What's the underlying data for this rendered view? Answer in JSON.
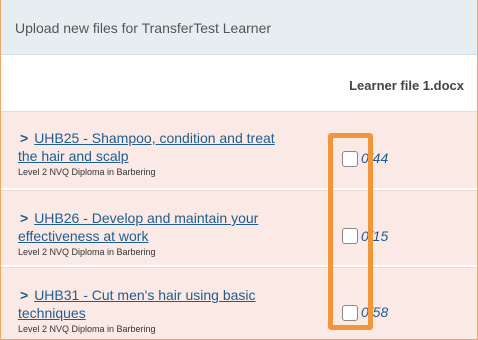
{
  "header": {
    "title": "Upload new files for TransferTest Learner"
  },
  "columns": {
    "file_label": "Learner file 1.docx"
  },
  "units": [
    {
      "title_line1": "UHB25 - Shampoo, condition and treat",
      "title_line2": "the hair and scalp",
      "qualification": "Level 2 NVQ Diploma in Barbering",
      "count": "0/44"
    },
    {
      "title_line1": "UHB26 - Develop and maintain your",
      "title_line2": "effectiveness at work",
      "qualification": "Level 2 NVQ Diploma in Barbering",
      "count": "0/15"
    },
    {
      "title_line1": "UHB31 - Cut men's hair using basic",
      "title_line2": "techniques",
      "qualification": "Level 2 NVQ Diploma in Barbering",
      "count": "0/58"
    }
  ],
  "colors": {
    "header_bg": "#e7eef2",
    "row_bg": "#fbe9e5",
    "link": "#1e5e8d",
    "highlight": "#f2963c"
  },
  "icons": {
    "expand": "chevron-right-icon"
  }
}
